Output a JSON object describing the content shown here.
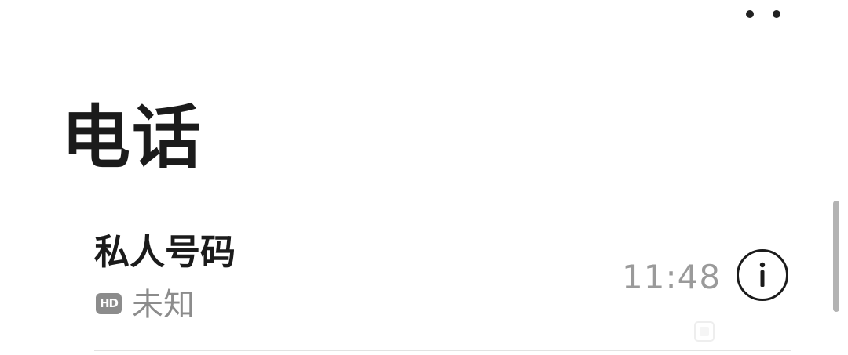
{
  "header": {
    "title": "电话",
    "more_icon": "more-dots-icon"
  },
  "call_log": [
    {
      "name": "私人号码",
      "hd_badge": "HD",
      "location": "未知",
      "time": "11:48",
      "info_icon": "info-icon"
    }
  ],
  "colors": {
    "background": "#ffffff",
    "primary_text": "#1b1b1b",
    "secondary_text": "#8c8c8c",
    "divider": "#e2e2e2",
    "scrollbar": "#b3b3b3"
  }
}
